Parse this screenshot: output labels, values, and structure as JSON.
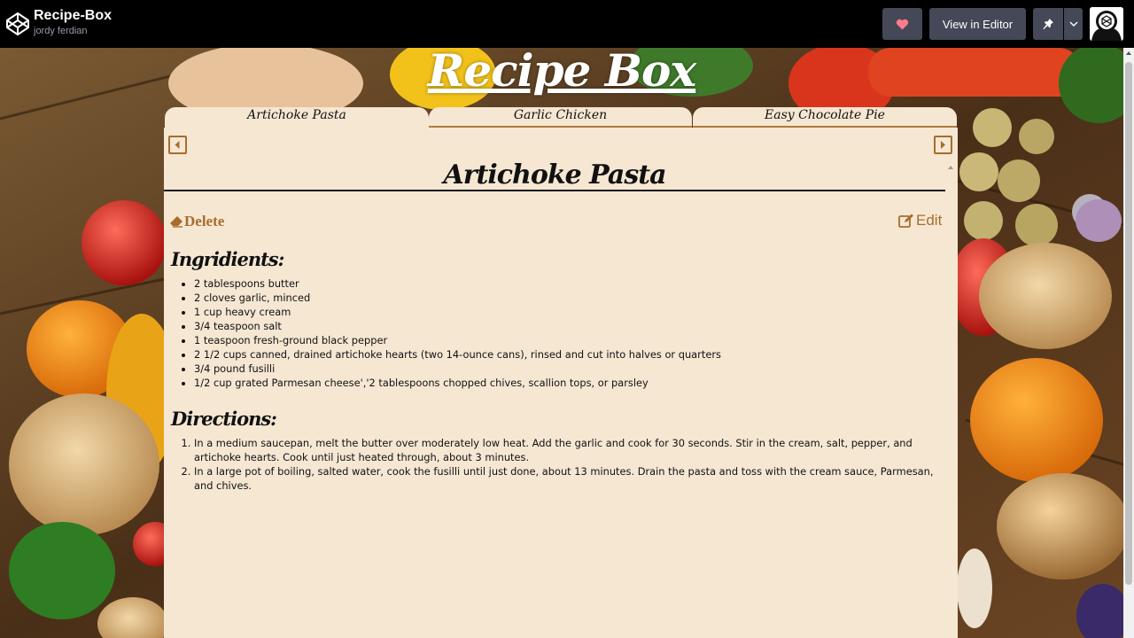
{
  "header": {
    "pen_title": "Recipe-Box",
    "author": "jordy ferdian",
    "view_in_editor": "View in Editor",
    "like_color": "#ff7a8a"
  },
  "app": {
    "title": "Recipe Box"
  },
  "tabs": [
    {
      "label": "Artichoke Pasta",
      "active": true
    },
    {
      "label": "Garlic Chicken",
      "active": false
    },
    {
      "label": "Easy Chocolate Pie",
      "active": false
    }
  ],
  "recipe": {
    "title": "Artichoke Pasta",
    "delete_label": "Delete",
    "edit_label": "Edit",
    "ingredients_heading": "Ingridients:",
    "ingredients": [
      "2 tablespoons butter",
      "2 cloves garlic, minced",
      "1 cup heavy cream",
      "3/4 teaspoon salt",
      "1 teaspoon fresh-ground black pepper",
      "2 1/2 cups canned, drained artichoke hearts (two 14-ounce cans), rinsed and cut into halves or quarters",
      "3/4 pound fusilli",
      "1/2 cup grated Parmesan cheese','2 tablespoons chopped chives, scallion tops, or parsley"
    ],
    "directions_heading": "Directions:",
    "directions": [
      "In a medium saucepan, melt the butter over moderately low heat. Add the garlic and cook for 30 seconds. Stir in the cream, salt, pepper, and artichoke hearts. Cook until just heated through, about 3 minutes.",
      "In a large pot of boiling, salted water, cook the fusilli until just done, about 13 minutes. Drain the pasta and toss with the cream sauce, Parmesan, and chives."
    ]
  },
  "colors": {
    "card_bg": "#f6e7d3",
    "accent": "#a86c2c"
  }
}
